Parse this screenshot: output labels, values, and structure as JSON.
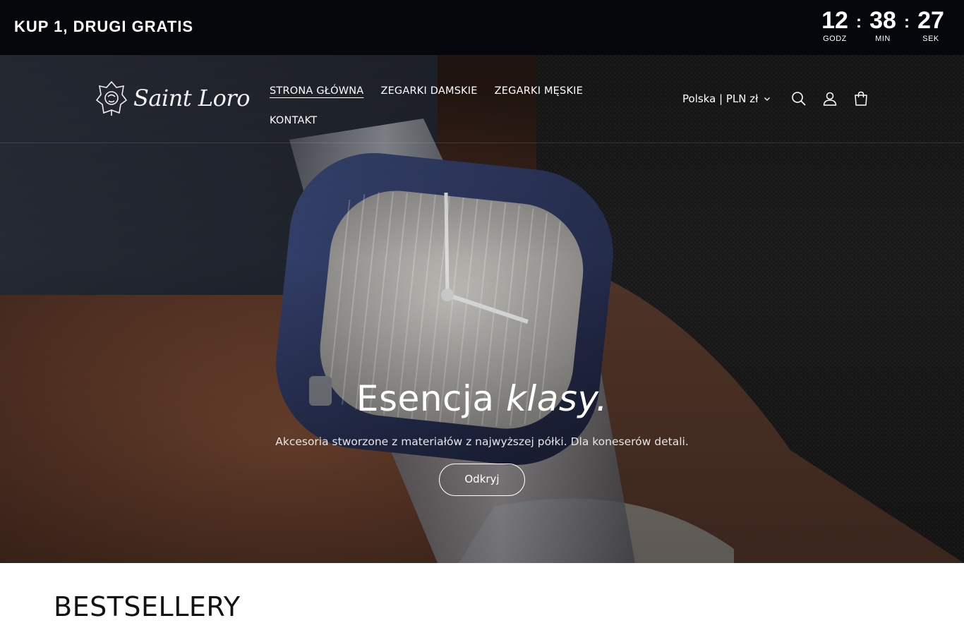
{
  "announcement": {
    "promo_text": "KUP 1, DRUGI GRATIS",
    "countdown": {
      "hours": "12",
      "hours_label": "GODZ",
      "minutes": "38",
      "minutes_label": "MIN",
      "seconds": "27",
      "seconds_label": "SEK",
      "separator": ":"
    }
  },
  "header": {
    "logo_text": "Saint Loro",
    "nav": [
      {
        "label": "STRONA GŁÓWNA",
        "active": true
      },
      {
        "label": "ZEGARKI DAMSKIE",
        "active": false
      },
      {
        "label": "ZEGARKI MĘSKIE",
        "active": false
      },
      {
        "label": "KONTAKT",
        "active": false
      }
    ],
    "locale_label": "Polska | PLN zł",
    "icons": [
      "search-icon",
      "account-icon",
      "cart-icon"
    ]
  },
  "hero": {
    "title_main": "Esencja ",
    "title_emphasis": "klasy.",
    "subtitle": "Akcesoria stworzone z materiałów z najwyższej półki. Dla koneserów detali.",
    "button_label": "Odkryj"
  },
  "bestsellers": {
    "heading": "BESTSELLERY"
  },
  "colors": {
    "announcement_bg": "#05070c",
    "text_light": "#ffffff",
    "heading_dark": "#121212"
  }
}
